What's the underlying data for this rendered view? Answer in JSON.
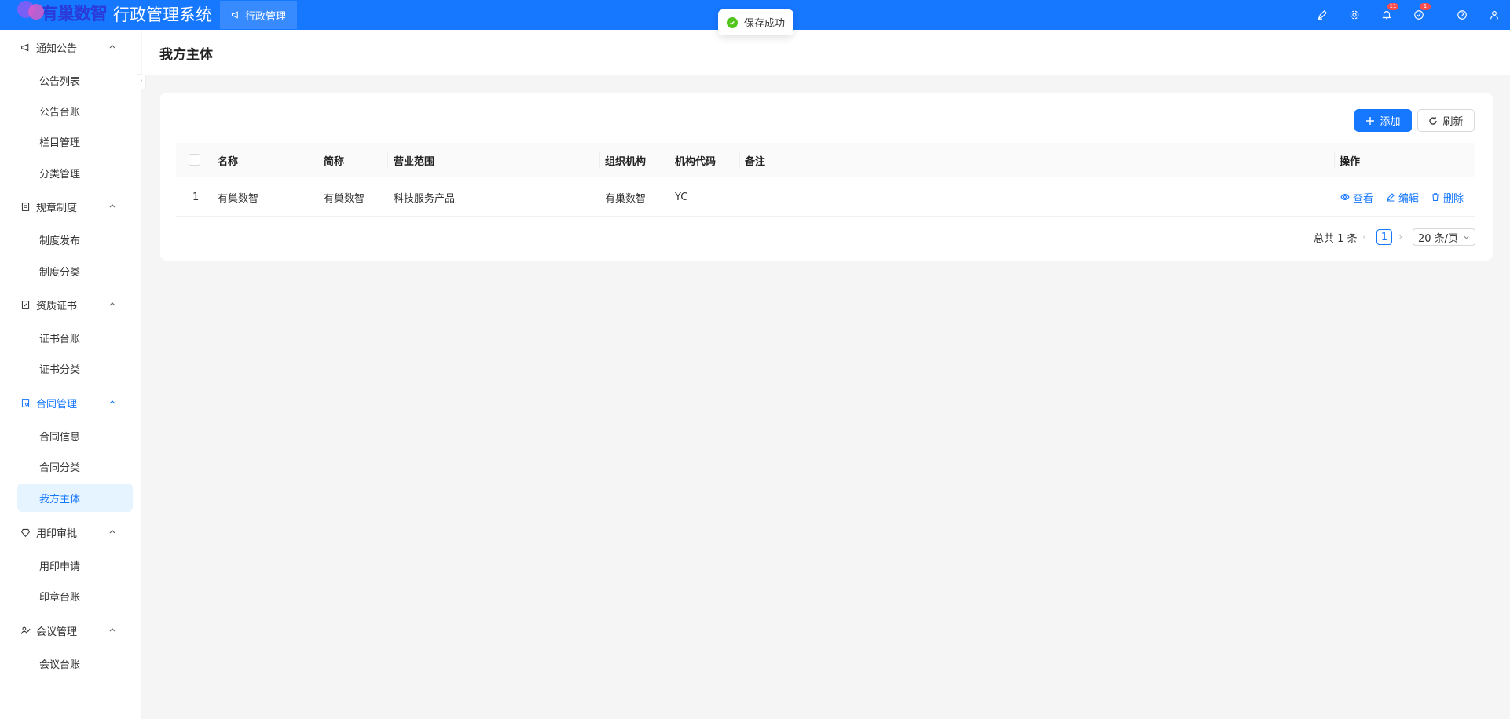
{
  "header": {
    "brand": "有巢数智",
    "app_title": "行政管理系统",
    "tab_label": "行政管理",
    "badges": {
      "notifications": "11",
      "tasks": "1"
    }
  },
  "toast": {
    "text": "保存成功"
  },
  "sidebar": {
    "groups": [
      {
        "label": "通知公告",
        "icon": "megaphone-icon",
        "items": [
          "公告列表",
          "公告台账",
          "栏目管理",
          "分类管理"
        ]
      },
      {
        "label": "规章制度",
        "icon": "document-icon",
        "items": [
          "制度发布",
          "制度分类"
        ]
      },
      {
        "label": "资质证书",
        "icon": "certificate-icon",
        "items": [
          "证书台账",
          "证书分类"
        ]
      },
      {
        "label": "合同管理",
        "icon": "contract-icon",
        "items": [
          "合同信息",
          "合同分类",
          "我方主体"
        ]
      },
      {
        "label": "用印审批",
        "icon": "seal-icon",
        "items": [
          "用印申请",
          "印章台账"
        ]
      },
      {
        "label": "会议管理",
        "icon": "meeting-icon",
        "items": [
          "会议台账"
        ]
      }
    ],
    "active_group": "合同管理",
    "active_item": "我方主体"
  },
  "page": {
    "title": "我方主体",
    "add_label": "添加",
    "refresh_label": "刷新"
  },
  "table": {
    "columns": [
      "名称",
      "简称",
      "营业范围",
      "组织机构",
      "机构代码",
      "备注",
      "操作"
    ],
    "rows": [
      {
        "index": "1",
        "name": "有巢数智",
        "short": "有巢数智",
        "scope": "科技服务产品",
        "org": "有巢数智",
        "code": "YC",
        "remark": ""
      }
    ],
    "actions": [
      "查看",
      "编辑",
      "删除"
    ]
  },
  "pagination": {
    "total_text": "总共 1 条",
    "current_page": "1",
    "page_size": "20 条/页"
  },
  "colors": {
    "primary": "#1677ff",
    "success": "#52c41a",
    "danger": "#ff4d4f"
  }
}
